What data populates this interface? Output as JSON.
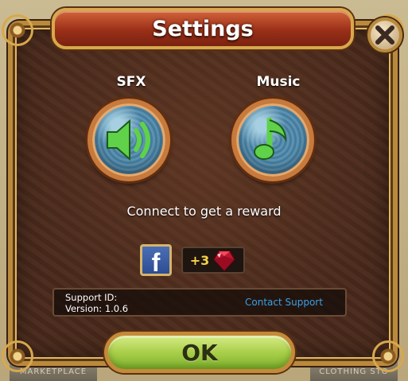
{
  "dialog": {
    "title": "Settings",
    "close_icon": "close-x-icon"
  },
  "audio": {
    "sfx_label": "SFX",
    "sfx_icon": "speaker-icon",
    "music_label": "Music",
    "music_icon": "music-note-icon"
  },
  "reward": {
    "connect_text": "Connect to get a reward",
    "facebook_letter": "f",
    "amount": "+3",
    "reward_icon": "gem-icon"
  },
  "support": {
    "support_id_label": "Support ID:",
    "version_label": "Version:  1.0.6",
    "contact_link": "Contact Support"
  },
  "footer": {
    "ok_label": "OK",
    "background_tab_left": "MARKETPLACE",
    "background_tab_right": "CLOTHING STO"
  },
  "colors": {
    "panel": "#4a2a1c",
    "frame_gold": "#b98a3c",
    "banner_red": "#9a2f18",
    "ok_green": "#a9cf4a",
    "link_blue": "#3aa0e6",
    "reward_yellow": "#f5d246"
  }
}
